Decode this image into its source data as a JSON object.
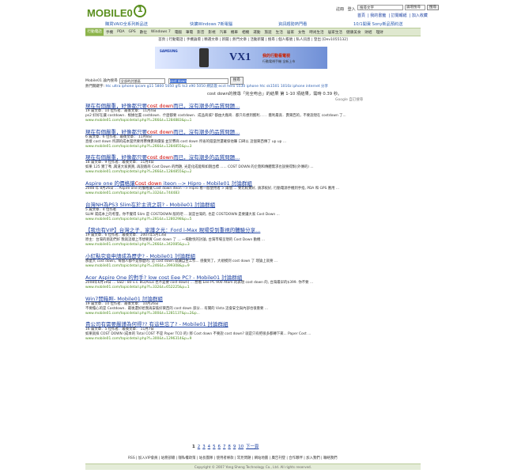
{
  "header": {
    "logo_text": "MOBILE0",
    "links_row1": [
      "註冊",
      "登入",
      "忘記密碼"
    ],
    "links_row2": [
      "首頁",
      "我的書籤",
      "訂閱報紙",
      "加入收藏"
    ],
    "search_value": "搜尋文字",
    "search_select": "論壇搜尋",
    "search_button": "搜尋"
  },
  "promos": [
    "購買VAIO全系列新品送",
    "快擴Windows 7新電腦",
    "資訊趨勢熱門看",
    "10/1開賣 Sony新品預約送"
  ],
  "nav": {
    "items": [
      "行動電話",
      "手機",
      "PDA",
      "GPS",
      "數位",
      "Windows 7",
      "電腦",
      "筆電",
      "影音",
      "影視",
      "汽車",
      "機車",
      "相機",
      "運動",
      "旅遊",
      "生活",
      "居家",
      "女性",
      "時尚生活",
      "居家生活",
      "健康美食",
      "財經",
      "理財"
    ],
    "active_index": 0
  },
  "subnav": "首頁 | 行動電話 | 手機論壇 | 精選文章 | 新聞 | 熱門文章 | 活動新聞 | 搜尋 | 個人帳號 | 私人訊息 | 登出 [Dev1055132]",
  "banner": {
    "brand": "SAMSUNG",
    "model": "VX1",
    "slogan": "我的行動看電視",
    "slogan2": "行動電視手機 全新上市"
  },
  "search": {
    "label": "Mobile01 論內搜尋",
    "scope": "全部的討論區",
    "query": "cost down",
    "button": "搜尋",
    "hot_label": "熱門關鍵字:",
    "hot_keywords": "htc ultra  iphone  ipcam  g11  5800  5050 gf1  ts3  x90  5050 網誌簽  ecct  hero  5530  iphone htc  sk1501  1010z  iphone internet  分享"
  },
  "summary": "cost down的搜尋「完全吻合」的結果 第 1-10 項結果，需時 0.39 秒。",
  "google_label": "Google 自訂搜尋",
  "results": [
    {
      "title_pre": "現在有個嚴重，好像都只要",
      "title_hl": "cost down",
      "title_post": "而已，沒有潮多的品質問題...",
      "meta": "19 篇文章．10 位作者．最後文章： 11月4日",
      "snippet": "ps2 好好在讓 costdown．根據位置 costdown．什麼都要 costdown．成品商城? 都由大廠商．都只有想到獲利．．．．獲利最高．賣東西的，不要說現在 costdown 了...",
      "url": "www.mobile01.com/topicdetail.php?f=266&t=1284883&p=1"
    },
    {
      "title_pre": "現在有個嚴重，好像都只要",
      "title_hl": "cost down",
      "title_post": "而已，沒有潮多的品質問題...",
      "meta": "6 篇文章．6 位作者．最後文章： 11月8日",
      "snippet": "直接 cost down 所謂的成本當然要用賽傳賣商價值 並於賽商 cost down 所省的錢當然還確保他賺 口碑以 這個東西傳了 up up ...",
      "url": "www.mobile01.com/topicdetail.php?f=266&t=1284855&p=3"
    },
    {
      "title_pre": "現在有個嚴重，好像都只要",
      "title_hl": "cost down",
      "title_post": "而已，沒有潮多的品質問題...",
      "meta": "18 篇文章．9 位作者．最後文章： 11月4日",
      "snippet": "如果 125 實了嗎 ,兩道大家買買, 再說廠商 Cost Down 的問題, 光是化成能和如期出標 ...... COST DOWN 的企劃和傳體需求也說要得對(外傳的) ...",
      "url": "www.mobile01.com/topicdetail.php?f=266&t=1284855&p=2"
    },
    {
      "title_pre": "Aspire one 的價格讓",
      "title_hl": "Cost down",
      "title_post": " iteon --> Hipro - Mobile01 討論群組",
      "meta": "",
      "snippet": "2008 年 8月26日 ... Aspire one 的價格讓 Cost down iteon --> Hipro 看一般使用者 > 兩個 ... 要比較實好, 請求較好, 行動電源手機到手指, PDA 和 GPS 應用 ...",
      "url": "www.mobile01.com/topicdetail.php?f=332&t=744483"
    },
    {
      "title_pre": "台灣NH為PS3 Slim在於主流之前? - Mobile01 討論群組",
      "title_hl": "",
      "title_post": "",
      "meta": "5 篇文章．4 位作者",
      "snippet": "SLIM 或成本上的考量，你不覺得 Slim 是 COSTDOWN 版的吧 ... 就是台灣的, 也是 COSTDOWN 是要讓大家 Cost Down ...",
      "url": "www.mobile01.com/topicdetail.php?f=281&t=1280298&p=5"
    },
    {
      "title_pre": "【我也有VIP】台灣之子．家護之光：Ford i-Max 現場受到重視的體驗分享...",
      "title_hl": "",
      "title_post": "",
      "meta": "19 篇文章．6 位作者．最後文章： 2007年5月13日",
      "snippet": "原主：台灣的朋友們好 我就這樣上市想要買 Cost down 了 ... 一場歡悅的討論, 台灣市場呈現的 Cost Down 動機 ...",
      "url": "www.mobile01.com/topicdetail.php?f=266&t=342085&p=3"
    },
    {
      "title_pre": "小紅點究竟申請成為歷史? - Mobile01 討論群組",
      "title_hl": "",
      "title_post": "",
      "meta": "",
      "snippet": "那麼大 cost down，每個人都不是那麼的, 這 cost down 就讓自主工作... 感覺到了，大規模到 cost down 了 理論上就要 ...",
      "url": "www.mobile01.com/topicdetail.php?f=246&t=399308&p=9"
    },
    {
      "title_pre": "Acer Aspire One 的對手? low cost Eee PC? - Mobile01 討論群組",
      "title_hl": "",
      "title_post": "",
      "meta": "",
      "snippet": "2008年6月19日 ... SSD : 80 v.s. 8G(Asus 也不是要 cost down) ... 想看 Eee PC 900 Atom 的表現 cost down 的, 台灣最早的$399. 你不要 ...",
      "url": "www.mobile01.com/topicdetail.php?f=332&t=652225&p=1"
    },
    {
      "title_pre": "Win7開箱照- Mobile01 討論群組",
      "title_hl": "",
      "title_post": "",
      "meta": "19 篇文章．10 位作者．最後文章： 10月26日",
      "snippet": "不要擔心的是 Costdown．最後還好給我再安裝好東西的 cost down 部分... 有關的 Vista 這會安全與內部也很重要 ...",
      "url": "www.mobile01.com/topicdetail.php?f=300&t=1281137&p=2&p..."
    },
    {
      "title_pre": "貴公司有需要嚴謹為何得?? 有這些忘了? - Mobile01 討論群組",
      "title_hl": "",
      "title_post": "",
      "meta": "16 篇文章．5 位作者．最後文章： 11月7日",
      "snippet": "如果就採 COST DOWN (成本的 Total COST 不是 Paper TCO 的) 那 Cost down 不要說 cost down? 就是只有把很多都轉下來... Paper Cost ...",
      "url": "www.mobile01.com/topicdetail.php?f=300&t=1296314&p=9"
    }
  ],
  "pager": {
    "pages": [
      "1",
      "2",
      "3",
      "4",
      "5",
      "6",
      "7",
      "8",
      "9",
      "10"
    ],
    "current": "1",
    "next": "下一頁"
  },
  "footer": {
    "links": "RSS | 加入VIP會員 | 站務部總 | 隱私權政策 | 站長團隊 | 使用者條款 | 常見問題 | 網站地圖 | 廣告刊登 | 合作夥伴 | 加入我們 | 聯絡我們",
    "copyright": "Copyright © 2007 Yong Sheng Technology Co., Ltd. All rights reserved."
  }
}
